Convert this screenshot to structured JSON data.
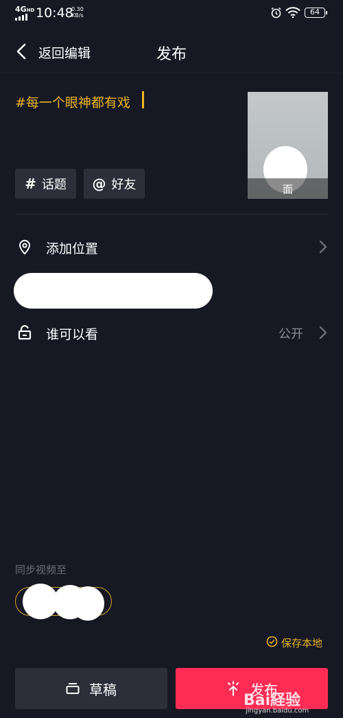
{
  "status_bar": {
    "network": "4G",
    "network_sup": "HD",
    "time": "10:48",
    "speed_value": "0.30",
    "speed_unit": "KB/s",
    "battery": "64",
    "icons": [
      "signal-icon",
      "alarm-icon",
      "wifi-icon",
      "battery-icon"
    ]
  },
  "header": {
    "back_label": "返回编辑",
    "title": "发布"
  },
  "caption": {
    "text": "#每一个眼神都有戏",
    "accent_color": "#e8b325"
  },
  "cover": {
    "label": "面"
  },
  "tags": {
    "topic_symbol": "#",
    "topic_label": "话题",
    "friend_symbol": "@",
    "friend_label": "好友"
  },
  "location": {
    "label": "添加位置",
    "icon": "location-pin-icon"
  },
  "visibility": {
    "label": "谁可以看",
    "value": "公开",
    "icon": "unlock-icon"
  },
  "sync": {
    "label": "同步视频至"
  },
  "save_local": {
    "label": "保存本地",
    "checked": true
  },
  "actions": {
    "draft_label": "草稿",
    "publish_label": "发布",
    "publish_color": "#fe2c55"
  },
  "watermark": {
    "brand": "Bai経验",
    "url": "jingyan.baidu.com"
  }
}
